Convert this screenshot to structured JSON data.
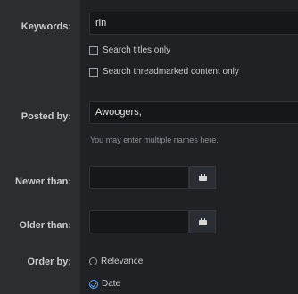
{
  "form": {
    "keywords": {
      "label": "Keywords:",
      "value": "rin"
    },
    "options": [
      {
        "label": "Search titles only",
        "checked": false
      },
      {
        "label": "Search threadmarked content only",
        "checked": false
      }
    ],
    "posted_by": {
      "label": "Posted by:",
      "value": "Awoogers,",
      "hint": "You may enter multiple names here."
    },
    "newer_than": {
      "label": "Newer than:",
      "value": ""
    },
    "older_than": {
      "label": "Older than:",
      "value": ""
    },
    "order_by": {
      "label": "Order by:",
      "options": [
        {
          "label": "Relevance",
          "selected": false
        },
        {
          "label": "Date",
          "selected": true
        }
      ]
    }
  },
  "icons": {
    "calendar": "calendar-icon",
    "checkmark": "checkmark-icon"
  },
  "colors": {
    "accent": "#5ba7ff",
    "panel": "#1f2124",
    "background": "#2b2d31"
  }
}
